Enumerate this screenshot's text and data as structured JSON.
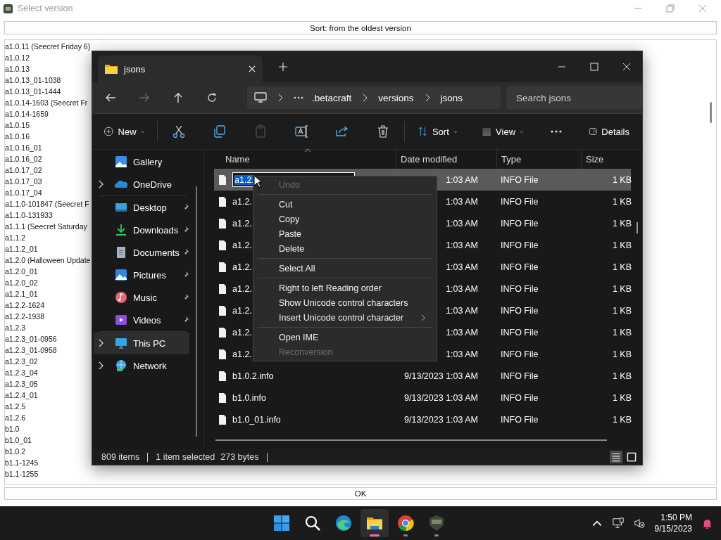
{
  "app_window": {
    "title": "Select version",
    "sort_button": "Sort: from the oldest version",
    "versions": [
      "a1.0.11 (Seecret Friday 6)",
      "a1.0.12",
      "a1.0.13",
      "a1.0.13_01-1038",
      "a1.0.13_01-1444",
      "a1.0.14-1603 (Seecret Fr",
      "a1.0.14-1659",
      "a1.0.15",
      "a1.0.16",
      "a1.0.16_01",
      "a1.0.16_02",
      "a1.0.17_02",
      "a1.0.17_03",
      "a1.0.17_04",
      "a1.1.0-101847 (Seecret F",
      "a1.1.0-131933",
      "a1.1.1 (Seecret Saturday",
      "a1.1.2",
      "a1.1.2_01",
      "a1.2.0 (Halloween Update",
      "a1.2.0_01",
      "a1.2.0_02",
      "a1.2.1_01",
      "a1.2.2-1624",
      "a1.2.2-1938",
      "a1.2.3",
      "a1.2.3_01-0956",
      "a1.2.3_01-0958",
      "a1.2.3_02",
      "a1.2.3_04",
      "a1.2.3_05",
      "a1.2.4_01",
      "a1.2.5",
      "a1.2.6",
      "b1.0",
      "b1.0_01",
      "b1.0.2",
      "b1.1-1245",
      "b1.1-1255"
    ],
    "ok_button": "OK"
  },
  "explorer": {
    "tab": {
      "title": "jsons"
    },
    "nav_buttons": [
      {
        "kind": "back",
        "disabled": false
      },
      {
        "kind": "forward",
        "disabled": true
      },
      {
        "kind": "up",
        "disabled": false
      },
      {
        "kind": "refresh",
        "disabled": false
      }
    ],
    "breadcrumb": [
      ".betacraft",
      "versions",
      "jsons"
    ],
    "search": {
      "placeholder": "Search jsons"
    },
    "toolbar_groups": [
      {
        "items": [
          {
            "kind": "new",
            "label": "New",
            "disabled": false
          }
        ]
      },
      {
        "items": [
          {
            "kind": "cut",
            "disabled": false
          },
          {
            "kind": "copy",
            "disabled": false
          },
          {
            "kind": "paste",
            "disabled": true
          },
          {
            "kind": "rename",
            "disabled": false
          },
          {
            "kind": "share",
            "disabled": false
          },
          {
            "kind": "delete",
            "disabled": false
          }
        ]
      },
      {
        "items": [
          {
            "kind": "sort",
            "label": "Sort",
            "disabled": false
          },
          {
            "kind": "view",
            "label": "View",
            "disabled": false
          },
          {
            "kind": "more",
            "disabled": false
          }
        ]
      }
    ],
    "details_pane": {
      "label": "Details"
    },
    "sidebar_groups": [
      {
        "items": [
          {
            "kind": "gallery",
            "label": "Gallery",
            "expandable": false,
            "pinned": false,
            "selected": false
          },
          {
            "kind": "onedrive",
            "label": "OneDrive",
            "expandable": true,
            "pinned": false,
            "selected": false
          }
        ]
      },
      {
        "items": [
          {
            "kind": "desktop",
            "label": "Desktop",
            "expandable": false,
            "pinned": true,
            "selected": false
          },
          {
            "kind": "downloads",
            "label": "Downloads",
            "expandable": false,
            "pinned": true,
            "selected": false
          },
          {
            "kind": "documents",
            "label": "Documents",
            "expandable": false,
            "pinned": true,
            "selected": false
          },
          {
            "kind": "pictures",
            "label": "Pictures",
            "expandable": false,
            "pinned": true,
            "selected": false
          },
          {
            "kind": "music",
            "label": "Music",
            "expandable": false,
            "pinned": true,
            "selected": false
          },
          {
            "kind": "videos",
            "label": "Videos",
            "expandable": false,
            "pinned": true,
            "selected": false
          }
        ]
      },
      {
        "items": [
          {
            "kind": "thispc",
            "label": "This PC",
            "expandable": true,
            "pinned": false,
            "selected": true
          },
          {
            "kind": "network",
            "label": "Network",
            "expandable": true,
            "pinned": false,
            "selected": false
          }
        ]
      }
    ],
    "columns": [
      "Name",
      "Date modified",
      "Type",
      "Size"
    ],
    "rows": [
      {
        "name": "a1.2.",
        "date": "1:03 AM",
        "type": "INFO File",
        "size": "1 KB",
        "selected": true,
        "editing": true
      },
      {
        "name": "a1.2.",
        "date": "1:03 AM",
        "type": "INFO File",
        "size": "1 KB",
        "selected": false,
        "editing": false
      },
      {
        "name": "a1.2.",
        "date": "1:03 AM",
        "type": "INFO File",
        "size": "1 KB",
        "selected": false,
        "editing": false
      },
      {
        "name": "a1.2.",
        "date": "1:03 AM",
        "type": "INFO File",
        "size": "1 KB",
        "selected": false,
        "editing": false
      },
      {
        "name": "a1.2.",
        "date": "1:03 AM",
        "type": "INFO File",
        "size": "1 KB",
        "selected": false,
        "editing": false
      },
      {
        "name": "a1.2.",
        "date": "1:03 AM",
        "type": "INFO File",
        "size": "1 KB",
        "selected": false,
        "editing": false
      },
      {
        "name": "a1.2.",
        "date": "1:03 AM",
        "type": "INFO File",
        "size": "1 KB",
        "selected": false,
        "editing": false
      },
      {
        "name": "a1.2.",
        "date": "1:03 AM",
        "type": "INFO File",
        "size": "1 KB",
        "selected": false,
        "editing": false
      },
      {
        "name": "a1.2.",
        "date": "1:03 AM",
        "type": "INFO File",
        "size": "1 KB",
        "selected": false,
        "editing": false
      },
      {
        "name": "b1.0.2.info",
        "date": "9/13/2023 1:03 AM",
        "type": "INFO File",
        "size": "1 KB",
        "selected": false,
        "editing": false
      },
      {
        "name": "b1.0.info",
        "date": "9/13/2023 1:03 AM",
        "type": "INFO File",
        "size": "1 KB",
        "selected": false,
        "editing": false
      },
      {
        "name": "b1.0_01.info",
        "date": "9/13/2023 1:03 AM",
        "type": "INFO File",
        "size": "1 KB",
        "selected": false,
        "editing": false
      }
    ],
    "status": {
      "count": "809 items",
      "selection": "1 item selected",
      "size": "273 bytes"
    },
    "view_modes": [
      {
        "kind": "details",
        "selected": true
      },
      {
        "kind": "tiles",
        "selected": false
      }
    ]
  },
  "context_menu": {
    "groups": [
      {
        "items": [
          {
            "label": "Undo",
            "disabled": true,
            "submenu": false
          }
        ]
      },
      {
        "items": [
          {
            "label": "Cut",
            "disabled": false,
            "submenu": false
          },
          {
            "label": "Copy",
            "disabled": false,
            "submenu": false
          },
          {
            "label": "Paste",
            "disabled": false,
            "submenu": false
          },
          {
            "label": "Delete",
            "disabled": false,
            "submenu": false
          }
        ]
      },
      {
        "items": [
          {
            "label": "Select All",
            "disabled": false,
            "submenu": false
          }
        ]
      },
      {
        "items": [
          {
            "label": "Right to left Reading order",
            "disabled": false,
            "submenu": false
          },
          {
            "label": "Show Unicode control characters",
            "disabled": false,
            "submenu": false
          },
          {
            "label": "Insert Unicode control character",
            "disabled": false,
            "submenu": true
          }
        ]
      },
      {
        "items": [
          {
            "label": "Open IME",
            "disabled": false,
            "submenu": false
          },
          {
            "label": "Reconversion",
            "disabled": true,
            "submenu": false
          }
        ]
      }
    ]
  },
  "taskbar": {
    "apps": [
      {
        "kind": "start",
        "selected": false,
        "running": false
      },
      {
        "kind": "search",
        "selected": false,
        "running": false
      },
      {
        "kind": "edge",
        "selected": false,
        "running": false
      },
      {
        "kind": "explorer",
        "selected": true,
        "running": true
      },
      {
        "kind": "chrome",
        "selected": false,
        "running": true
      },
      {
        "kind": "game",
        "selected": false,
        "running": true
      }
    ],
    "clock": {
      "time": "1:50 PM",
      "date": "9/15/2023"
    }
  }
}
